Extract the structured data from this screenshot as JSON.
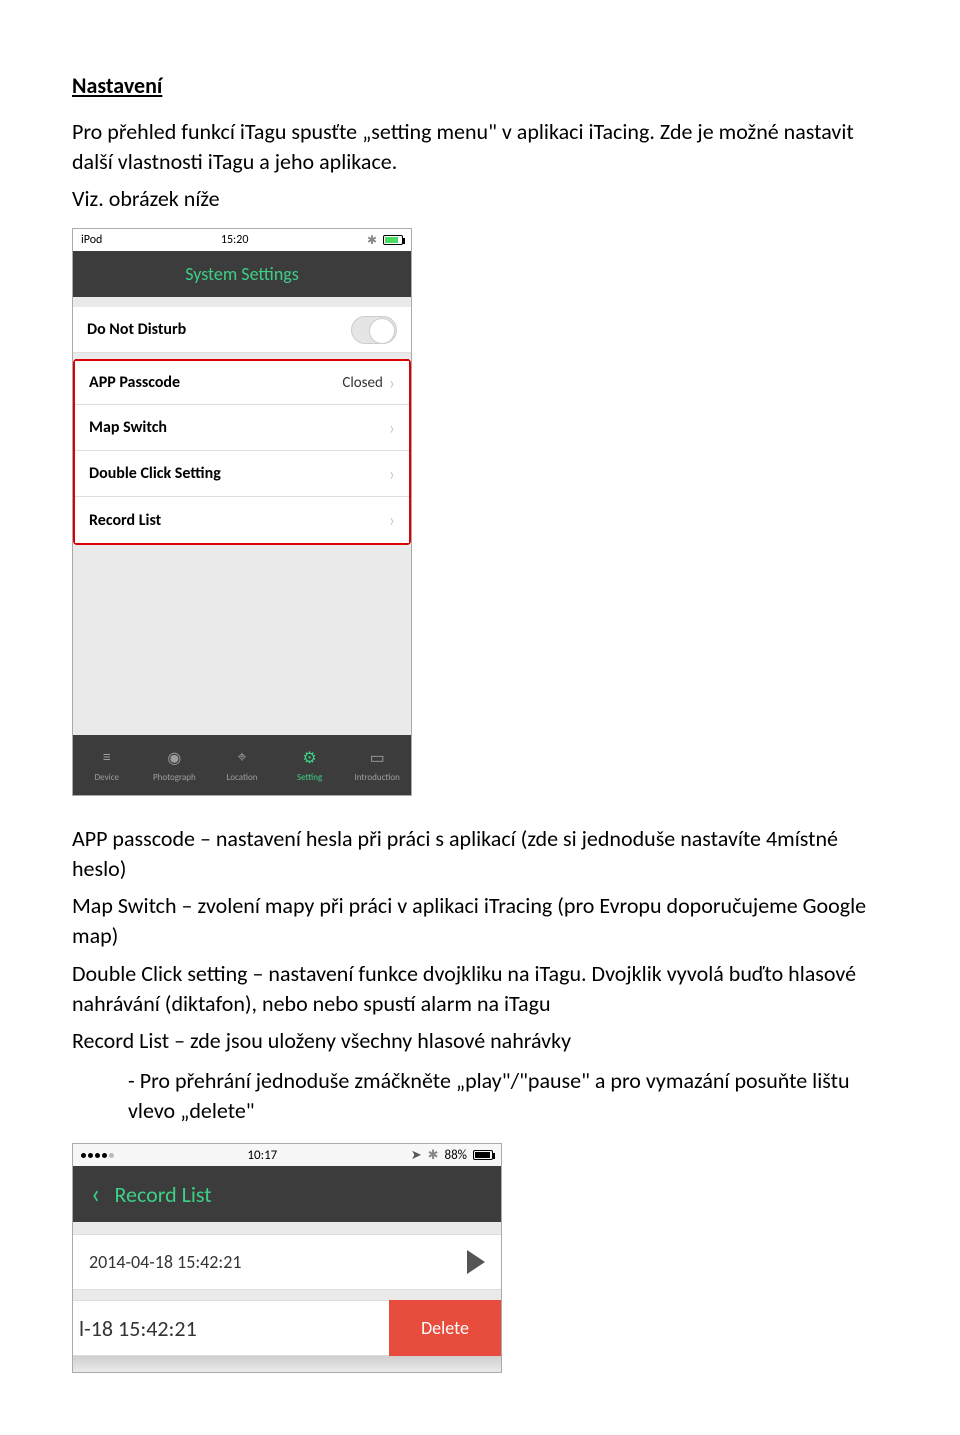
{
  "section_title": "Nastavení",
  "intro1": "Pro přehled funkcí iTagu spusťte „setting menu\" v aplikaci iTacing. Zde je možné nastavit další vlastnosti iTagu a jeho aplikace.",
  "intro2": "Viz. obrázek níže",
  "phone1": {
    "status": {
      "left": "iPod",
      "time": "15:20",
      "bt": "✱"
    },
    "title": "System Settings",
    "rows": {
      "dnd": "Do Not Disturb",
      "passcode": "APP Passcode",
      "passcode_val": "Closed",
      "mapswitch": "Map Switch",
      "dblclick": "Double Click Setting",
      "reclist": "Record List"
    },
    "tabs": {
      "device": "Device",
      "photograph": "Photograph",
      "location": "Location",
      "setting": "Setting",
      "introduction": "Introduction"
    }
  },
  "desc": {
    "passcode": "APP passcode – nastavení hesla při práci s aplikací (zde si jednoduše nastavíte 4místné heslo)",
    "mapswitch": "Map Switch – zvolení mapy při práci v aplikaci iTracing (pro Evropu doporučujeme Google map)",
    "dblclick": "Double Click setting – nastavení funkce dvojkliku na iTagu. Dvojklik vyvolá buďto hlasové nahrávání (diktafon), nebo nebo spustí alarm na iTagu",
    "reclist": "Record List – zde jsou uloženy všechny hlasové nahrávky",
    "play_hint": "- Pro přehrání jednoduše zmáčkněte „play\"/\"pause\" a pro vymazání posuňte lištu vlevo „delete\""
  },
  "phone2": {
    "status": {
      "time": "10:17",
      "right": "88%"
    },
    "title": "Record List",
    "rec1": "2014-04-18 15:42:21",
    "rec2_partial": "l-18 15:42:21",
    "delete": "Delete"
  }
}
